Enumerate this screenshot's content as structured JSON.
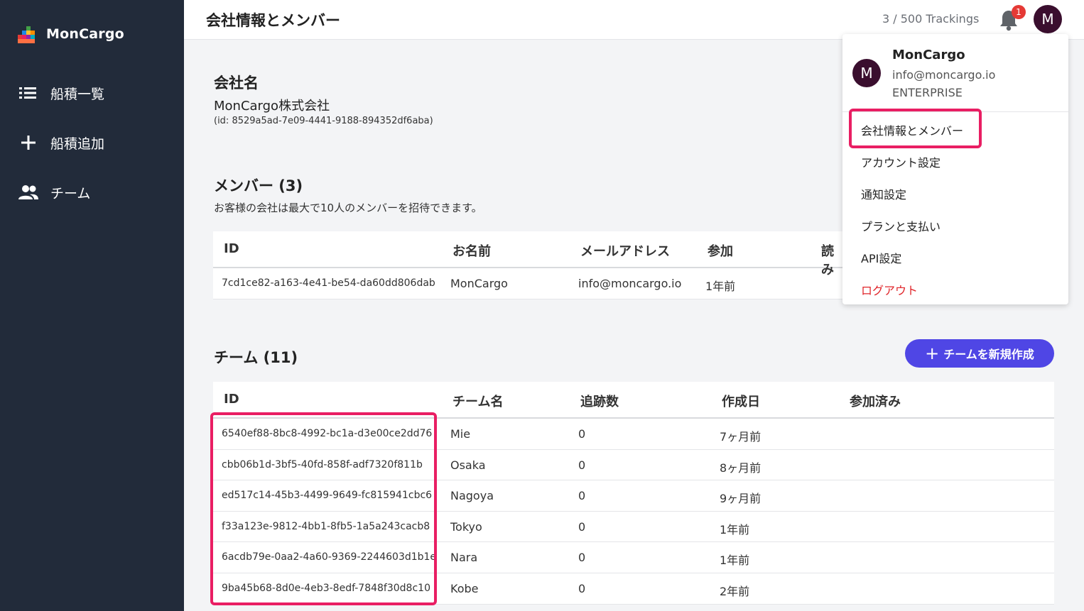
{
  "app": {
    "name": "MonCargo"
  },
  "sidebar": {
    "items": [
      {
        "label": "船積一覧",
        "icon": "list-icon"
      },
      {
        "label": "船積追加",
        "icon": "plus-icon"
      },
      {
        "label": "チーム",
        "icon": "people-icon"
      }
    ]
  },
  "header": {
    "title": "会社情報とメンバー",
    "tracking": "3 / 500 Trackings",
    "notification_count": "1",
    "avatar_letter": "M"
  },
  "company": {
    "heading": "会社名",
    "name": "MonCargo株式会社",
    "id": "(id: 8529a5ad-7e09-4441-9188-894352df6aba)"
  },
  "members": {
    "heading": "メンバー (3)",
    "description": "お客様の会社は最大で10人のメンバーを招待できます。",
    "columns": [
      "ID",
      "お名前",
      "メールアドレス",
      "参加",
      "読み"
    ],
    "rows": [
      {
        "id": "7cd1ce82-a163-4e41-be54-da60dd806dab",
        "name": "MonCargo",
        "email": "info@moncargo.io",
        "joined": "1年前"
      }
    ]
  },
  "teams": {
    "heading": "チーム (11)",
    "new_button": "チームを新規作成",
    "columns": [
      "ID",
      "チーム名",
      "追跡数",
      "作成日",
      "参加済み"
    ],
    "rows": [
      {
        "id": "6540ef88-8bc8-4992-bc1a-d3e00ce2dd76",
        "name": "Mie",
        "count": "0",
        "created": "7ヶ月前"
      },
      {
        "id": "cbb06b1d-3bf5-40fd-858f-adf7320f811b",
        "name": "Osaka",
        "count": "0",
        "created": "8ヶ月前"
      },
      {
        "id": "ed517c14-45b3-4499-9649-fc815941cbc6",
        "name": "Nagoya",
        "count": "0",
        "created": "9ヶ月前"
      },
      {
        "id": "f33a123e-9812-4bb1-8fb5-1a5a243cacb8",
        "name": "Tokyo",
        "count": "0",
        "created": "1年前"
      },
      {
        "id": "6acdb79e-0aa2-4a60-9369-2244603d1b1e",
        "name": "Nara",
        "count": "0",
        "created": "1年前"
      },
      {
        "id": "9ba45b68-8d0e-4eb3-8edf-7848f30d8c10",
        "name": "Kobe",
        "count": "0",
        "created": "2年前"
      }
    ]
  },
  "user_menu": {
    "avatar_letter": "M",
    "name": "MonCargo",
    "email": "info@moncargo.io",
    "plan": "ENTERPRISE",
    "items": [
      "会社情報とメンバー",
      "アカウント設定",
      "通知設定",
      "プランと支払い",
      "API設定",
      "ログアウト"
    ]
  },
  "colors": {
    "sidebar_bg": "#222b3a",
    "accent": "#4f46e5",
    "highlight": "#e91e63",
    "logout": "#e0262b",
    "avatar_bg": "#3a0e2e"
  }
}
